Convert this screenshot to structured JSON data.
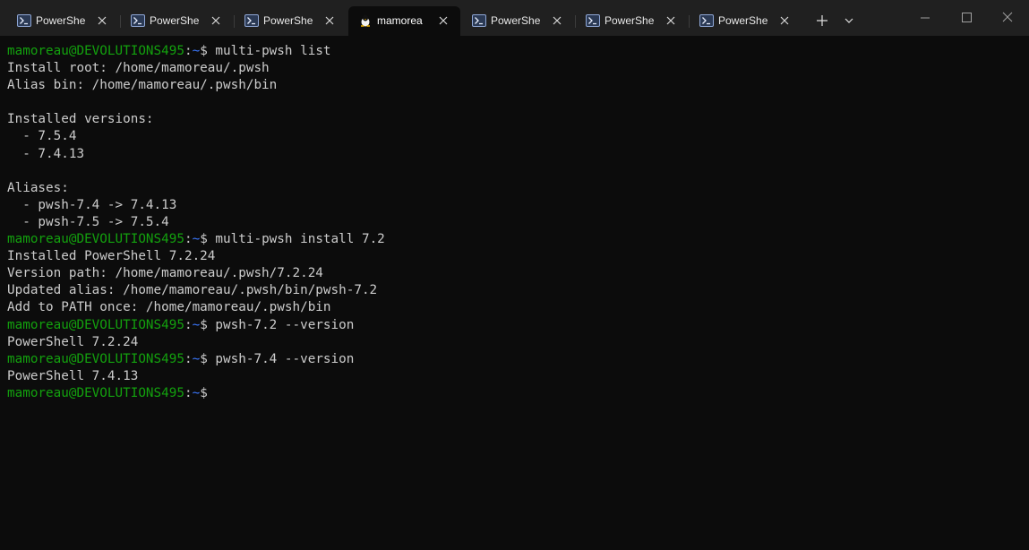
{
  "tabs": [
    {
      "title": "PowerShe",
      "icon": "powershell-icon",
      "active": false
    },
    {
      "title": "PowerShe",
      "icon": "powershell-icon",
      "active": false
    },
    {
      "title": "PowerShe",
      "icon": "powershell-icon",
      "active": false
    },
    {
      "title": "mamorea",
      "icon": "linux-tux-icon",
      "active": true
    },
    {
      "title": "PowerShe",
      "icon": "powershell-icon",
      "active": false
    },
    {
      "title": "PowerShe",
      "icon": "powershell-icon",
      "active": false
    },
    {
      "title": "PowerShe",
      "icon": "powershell-icon",
      "active": false
    }
  ],
  "titlebar": {
    "new_tab_icon": "plus-icon",
    "dropdown_icon": "chevron-down-icon",
    "minimize_icon": "minimize-icon",
    "maximize_icon": "maximize-icon",
    "close_icon": "close-icon"
  },
  "prompt": {
    "user_host": "mamoreau@DEVOLUTIONS495",
    "sep": ":",
    "path": "~",
    "symbol": "$ "
  },
  "colors": {
    "background": "#0c0c0c",
    "titlebar": "#202020",
    "text": "#cccccc",
    "prompt_user": "#13a10e",
    "prompt_path": "#3b78ff"
  },
  "terminal": {
    "lines": [
      {
        "type": "cmd",
        "text": "multi-pwsh list"
      },
      {
        "type": "out",
        "text": "Install root: /home/mamoreau/.pwsh"
      },
      {
        "type": "out",
        "text": "Alias bin: /home/mamoreau/.pwsh/bin"
      },
      {
        "type": "out",
        "text": ""
      },
      {
        "type": "out",
        "text": "Installed versions:"
      },
      {
        "type": "out",
        "text": "  - 7.5.4"
      },
      {
        "type": "out",
        "text": "  - 7.4.13"
      },
      {
        "type": "out",
        "text": ""
      },
      {
        "type": "out",
        "text": "Aliases:"
      },
      {
        "type": "out",
        "text": "  - pwsh-7.4 -> 7.4.13"
      },
      {
        "type": "out",
        "text": "  - pwsh-7.5 -> 7.5.4"
      },
      {
        "type": "cmd",
        "text": "multi-pwsh install 7.2"
      },
      {
        "type": "out",
        "text": "Installed PowerShell 7.2.24"
      },
      {
        "type": "out",
        "text": "Version path: /home/mamoreau/.pwsh/7.2.24"
      },
      {
        "type": "out",
        "text": "Updated alias: /home/mamoreau/.pwsh/bin/pwsh-7.2"
      },
      {
        "type": "out",
        "text": "Add to PATH once: /home/mamoreau/.pwsh/bin"
      },
      {
        "type": "cmd",
        "text": "pwsh-7.2 --version"
      },
      {
        "type": "out",
        "text": "PowerShell 7.2.24"
      },
      {
        "type": "cmd",
        "text": "pwsh-7.4 --version"
      },
      {
        "type": "out",
        "text": "PowerShell 7.4.13"
      },
      {
        "type": "cmd",
        "text": ""
      }
    ]
  }
}
